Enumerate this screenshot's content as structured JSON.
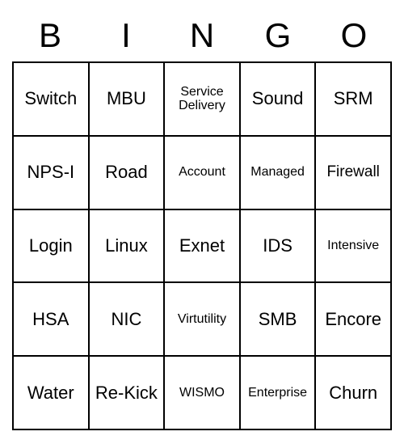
{
  "header": [
    "B",
    "I",
    "N",
    "G",
    "O"
  ],
  "cells": [
    [
      {
        "text": "Switch",
        "size": ""
      },
      {
        "text": "MBU",
        "size": ""
      },
      {
        "text": "Service Delivery",
        "size": "small"
      },
      {
        "text": "Sound",
        "size": ""
      },
      {
        "text": "SRM",
        "size": ""
      }
    ],
    [
      {
        "text": "NPS-I",
        "size": ""
      },
      {
        "text": "Road",
        "size": ""
      },
      {
        "text": "Account",
        "size": "small"
      },
      {
        "text": "Managed",
        "size": "small"
      },
      {
        "text": "Firewall",
        "size": "med"
      }
    ],
    [
      {
        "text": "Login",
        "size": ""
      },
      {
        "text": "Linux",
        "size": ""
      },
      {
        "text": "Exnet",
        "size": ""
      },
      {
        "text": "IDS",
        "size": ""
      },
      {
        "text": "Intensive",
        "size": "small"
      }
    ],
    [
      {
        "text": "HSA",
        "size": ""
      },
      {
        "text": "NIC",
        "size": ""
      },
      {
        "text": "Virtutility",
        "size": "small"
      },
      {
        "text": "SMB",
        "size": ""
      },
      {
        "text": "Encore",
        "size": ""
      }
    ],
    [
      {
        "text": "Water",
        "size": ""
      },
      {
        "text": "Re-Kick",
        "size": ""
      },
      {
        "text": "WISMO",
        "size": "small"
      },
      {
        "text": "Enterprise",
        "size": "small"
      },
      {
        "text": "Churn",
        "size": ""
      }
    ]
  ]
}
